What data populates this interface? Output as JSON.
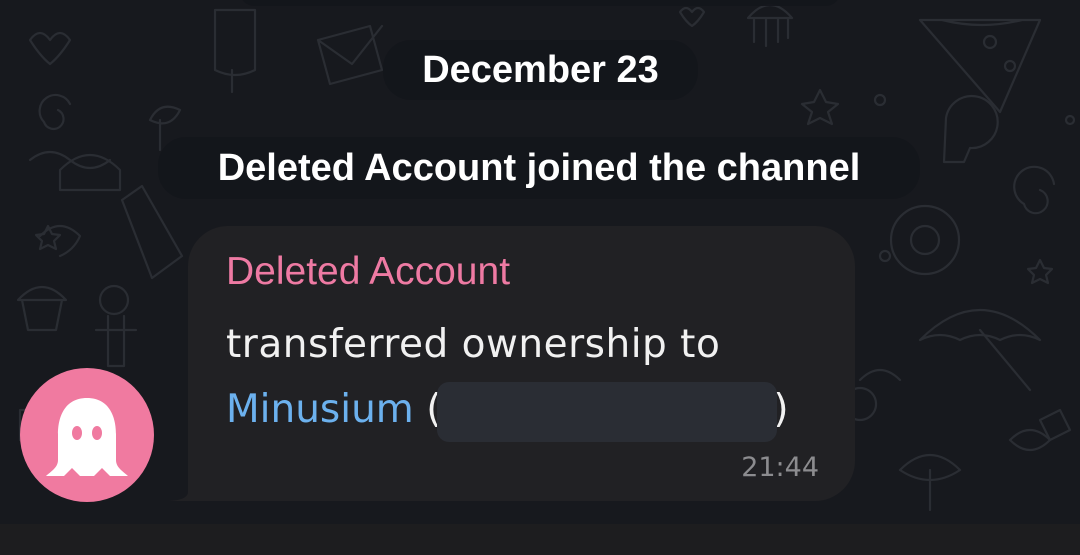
{
  "chat": {
    "date_separator": "December 23",
    "service_message": "Deleted Account joined the channel"
  },
  "message": {
    "sender": "Deleted Account",
    "text_line1": "transferred ownership to",
    "mention": "Minusium",
    "open_paren": " (",
    "close_paren": ")",
    "time": "21:44"
  },
  "avatar": {
    "icon": "ghost-icon",
    "color": "#f07aa0"
  },
  "colors": {
    "sender_name": "#ee7aa3",
    "mention_link": "#6cb1ee",
    "bubble": "#212124",
    "background": "#17191e"
  }
}
